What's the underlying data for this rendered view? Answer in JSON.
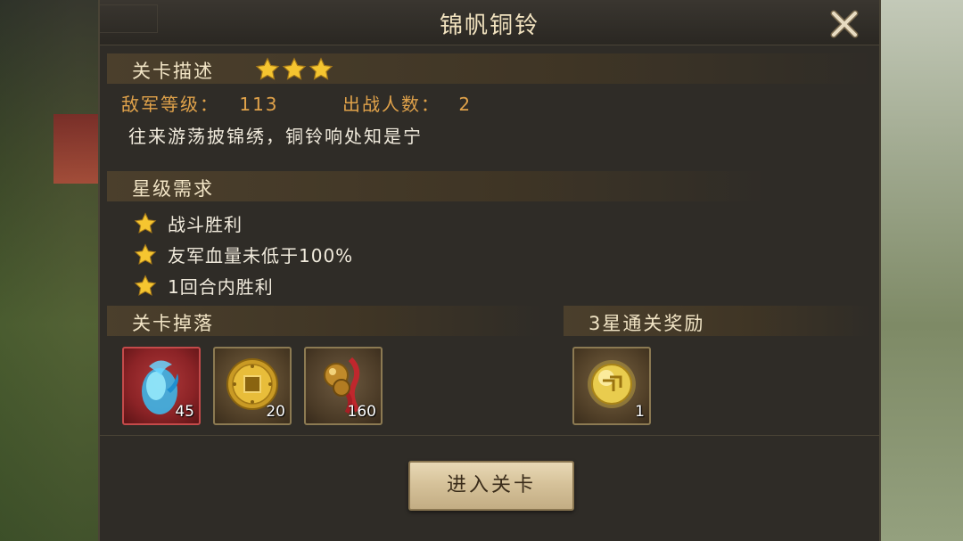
{
  "title": "锦帆铜铃",
  "stage_desc": {
    "label": "关卡描述",
    "stars": 3,
    "enemy_level_label": "敌军等级：",
    "enemy_level": "113",
    "troops_label": "出战人数：",
    "troops": "2",
    "poem": "往来游荡披锦绣，铜铃响处知是宁"
  },
  "star_requirements": {
    "label": "星级需求",
    "items": [
      "战斗胜利",
      "友军血量未低于100%",
      "1回合内胜利"
    ]
  },
  "drops": {
    "label": "关卡掉落",
    "items": [
      {
        "icon": "blue-soul-crystal-icon",
        "count": "45"
      },
      {
        "icon": "gold-coin-icon",
        "count": "20"
      },
      {
        "icon": "bronze-bell-icon",
        "count": "160"
      }
    ]
  },
  "reward": {
    "label": "3星通关奖励",
    "items": [
      {
        "icon": "gold-orb-icon",
        "count": "1"
      }
    ]
  },
  "enter_button": "进入关卡",
  "colors": {
    "panel_bg": "#2f2c27",
    "accent_text": "#e0a24a",
    "star": "#f5c530",
    "rare_frame": "#c44a4a"
  }
}
